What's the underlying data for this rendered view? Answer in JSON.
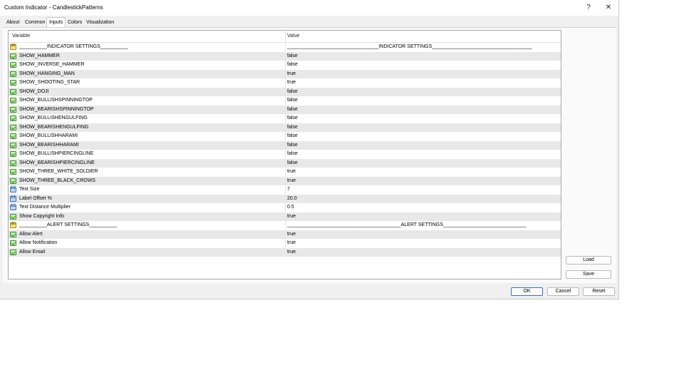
{
  "window": {
    "title": "Custom Indicator - CandlestickPatterns",
    "help_label": "?",
    "close_label": "✕"
  },
  "tabs": [
    "About",
    "Common",
    "Inputs",
    "Colors",
    "Visualization"
  ],
  "grid": {
    "col_variable": "Variable",
    "col_value": "Value",
    "rows": [
      {
        "icon": "string-icon",
        "variable": "__________INDICATOR SETTINGS__________",
        "value": "_________________________________INDICATOR SETTINGS____________________________________"
      },
      {
        "icon": "bool-icon",
        "variable": "SHOW_HAMMER",
        "value": "false"
      },
      {
        "icon": "bool-icon",
        "variable": "SHOW_INVERSE_HAMMER",
        "value": "false"
      },
      {
        "icon": "bool-icon",
        "variable": "SHOW_HANGING_MAN",
        "value": "true"
      },
      {
        "icon": "bool-icon",
        "variable": "SHOW_SHOOTING_STAR",
        "value": "true"
      },
      {
        "icon": "bool-icon",
        "variable": "SHOW_DOJI",
        "value": "false"
      },
      {
        "icon": "bool-icon",
        "variable": "SHOW_BULLISHSPINNINGTOP",
        "value": "false"
      },
      {
        "icon": "bool-icon",
        "variable": "SHOW_BEARISHSPINNINGTOP",
        "value": "false"
      },
      {
        "icon": "bool-icon",
        "variable": "SHOW_BULLISHENGULFING",
        "value": "false"
      },
      {
        "icon": "bool-icon",
        "variable": "SHOW_BEARISHENGULFING",
        "value": "false"
      },
      {
        "icon": "bool-icon",
        "variable": "SHOW_BULLISHHARAMI",
        "value": "false"
      },
      {
        "icon": "bool-icon",
        "variable": "SHOW_BEARISHHARAMI",
        "value": "false"
      },
      {
        "icon": "bool-icon",
        "variable": "SHOW_BULLISHPIERCINGLINE",
        "value": "false"
      },
      {
        "icon": "bool-icon",
        "variable": "SHOW_BEARISHPIERCINGLINE",
        "value": "false"
      },
      {
        "icon": "bool-icon",
        "variable": "SHOW_THREE_WHITE_SOLDIER",
        "value": "true"
      },
      {
        "icon": "bool-icon",
        "variable": "SHOW_THREE_BLACK_CROWS",
        "value": "true"
      },
      {
        "icon": "number-icon",
        "variable": "Text Size",
        "value": "7"
      },
      {
        "icon": "number-icon",
        "variable": "Label Offset %",
        "value": "20.0"
      },
      {
        "icon": "number-icon",
        "variable": "Text Distance Multiplier",
        "value": "0.5"
      },
      {
        "icon": "bool-icon",
        "variable": "Show Copyright Info",
        "value": "true"
      },
      {
        "icon": "string-icon",
        "variable": "__________ALERT SETTINGS__________",
        "value": "_________________________________________ALERT SETTINGS______________________________"
      },
      {
        "icon": "bool-icon",
        "variable": "Allow Alert",
        "value": "true"
      },
      {
        "icon": "bool-icon",
        "variable": "Allow Notification",
        "value": "true"
      },
      {
        "icon": "bool-icon",
        "variable": "Allow Email",
        "value": "true"
      }
    ]
  },
  "side_buttons": {
    "load": "Load",
    "save": "Save"
  },
  "footer": {
    "ok": "OK",
    "cancel": "Cancel",
    "reset": "Reset"
  },
  "colors": {
    "accent": "#3d6fc4",
    "row_shade": "#e8e8e8"
  }
}
